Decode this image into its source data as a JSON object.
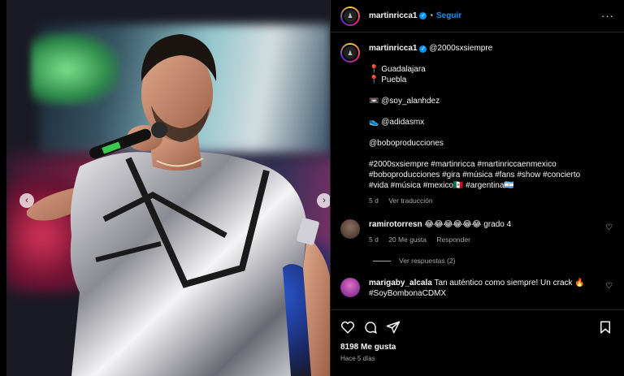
{
  "post": {
    "username": "martinricca1",
    "follow_label": "Seguir",
    "dot": "•",
    "more_label": "···"
  },
  "caption": {
    "username": "martinricca1",
    "mention": "@2000sxsiempre",
    "line1": "📍 Guadalajara",
    "line2": "📍 Puebla",
    "line3": "📼 @soy_alanhdez",
    "line4": "👟 @adidasmx",
    "line5": "@boboproducciones",
    "hashtags_1": "#2000sxsiempre #martinricca #martinriccaenmexico",
    "hashtags_2": "#boboproducciones #gira #música #fans #show #concierto",
    "hashtags_3": "#vida #música #mexico🇲🇽 #argentina🇦🇷",
    "age": "5 d",
    "translate": "Ver traducción"
  },
  "comments": [
    {
      "username": "ramirotorresn",
      "text": "😂😂😂😂😂😂 grado 4",
      "age": "5 d",
      "likes": "20 Me gusta",
      "reply": "Responder",
      "view_replies": "Ver respuestas (2)"
    },
    {
      "username": "marigaby_alcala",
      "text": "Tan auténtico como siempre! Un crack 🔥",
      "text2": "#SoyBombonaCDMX"
    }
  ],
  "footer": {
    "likes": "8198 Me gusta",
    "time": "Hace 5 días"
  },
  "colors": {
    "accent": "#0095f6",
    "background": "#000000",
    "muted": "#a8a8a8"
  },
  "icons": [
    "heart-icon",
    "comment-icon",
    "share-icon",
    "bookmark-icon",
    "verified-icon",
    "more-icon"
  ]
}
